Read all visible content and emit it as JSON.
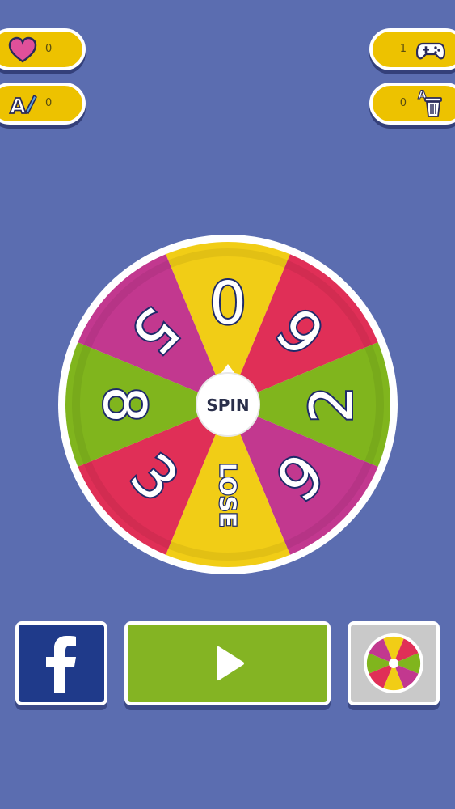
{
  "stats": {
    "likes": "0",
    "words": "0",
    "games": "1",
    "deleted": "0"
  },
  "wheel": {
    "center_label": "SPIN",
    "segments": [
      {
        "label": "0",
        "color": "#f1cd16"
      },
      {
        "label": "6",
        "color": "#e02f57"
      },
      {
        "label": "2",
        "color": "#80b51d"
      },
      {
        "label": "9",
        "color": "#c2388f"
      },
      {
        "label": "LOSE",
        "color": "#f1cd16"
      },
      {
        "label": "3",
        "color": "#e02f57"
      },
      {
        "label": "8",
        "color": "#80b51d"
      },
      {
        "label": "5",
        "color": "#c2388f"
      }
    ]
  },
  "icons": {
    "likes": "heart-icon",
    "words": "letter-pen-icon",
    "games": "gamepad-icon",
    "deleted": "trash-letter-icon",
    "facebook": "facebook-icon",
    "play": "play-icon",
    "wheel": "wheel-icon"
  },
  "colors": {
    "background": "#5b6db0",
    "pill": "#edc200",
    "facebook": "#1f3a8a",
    "play": "#84b423"
  }
}
